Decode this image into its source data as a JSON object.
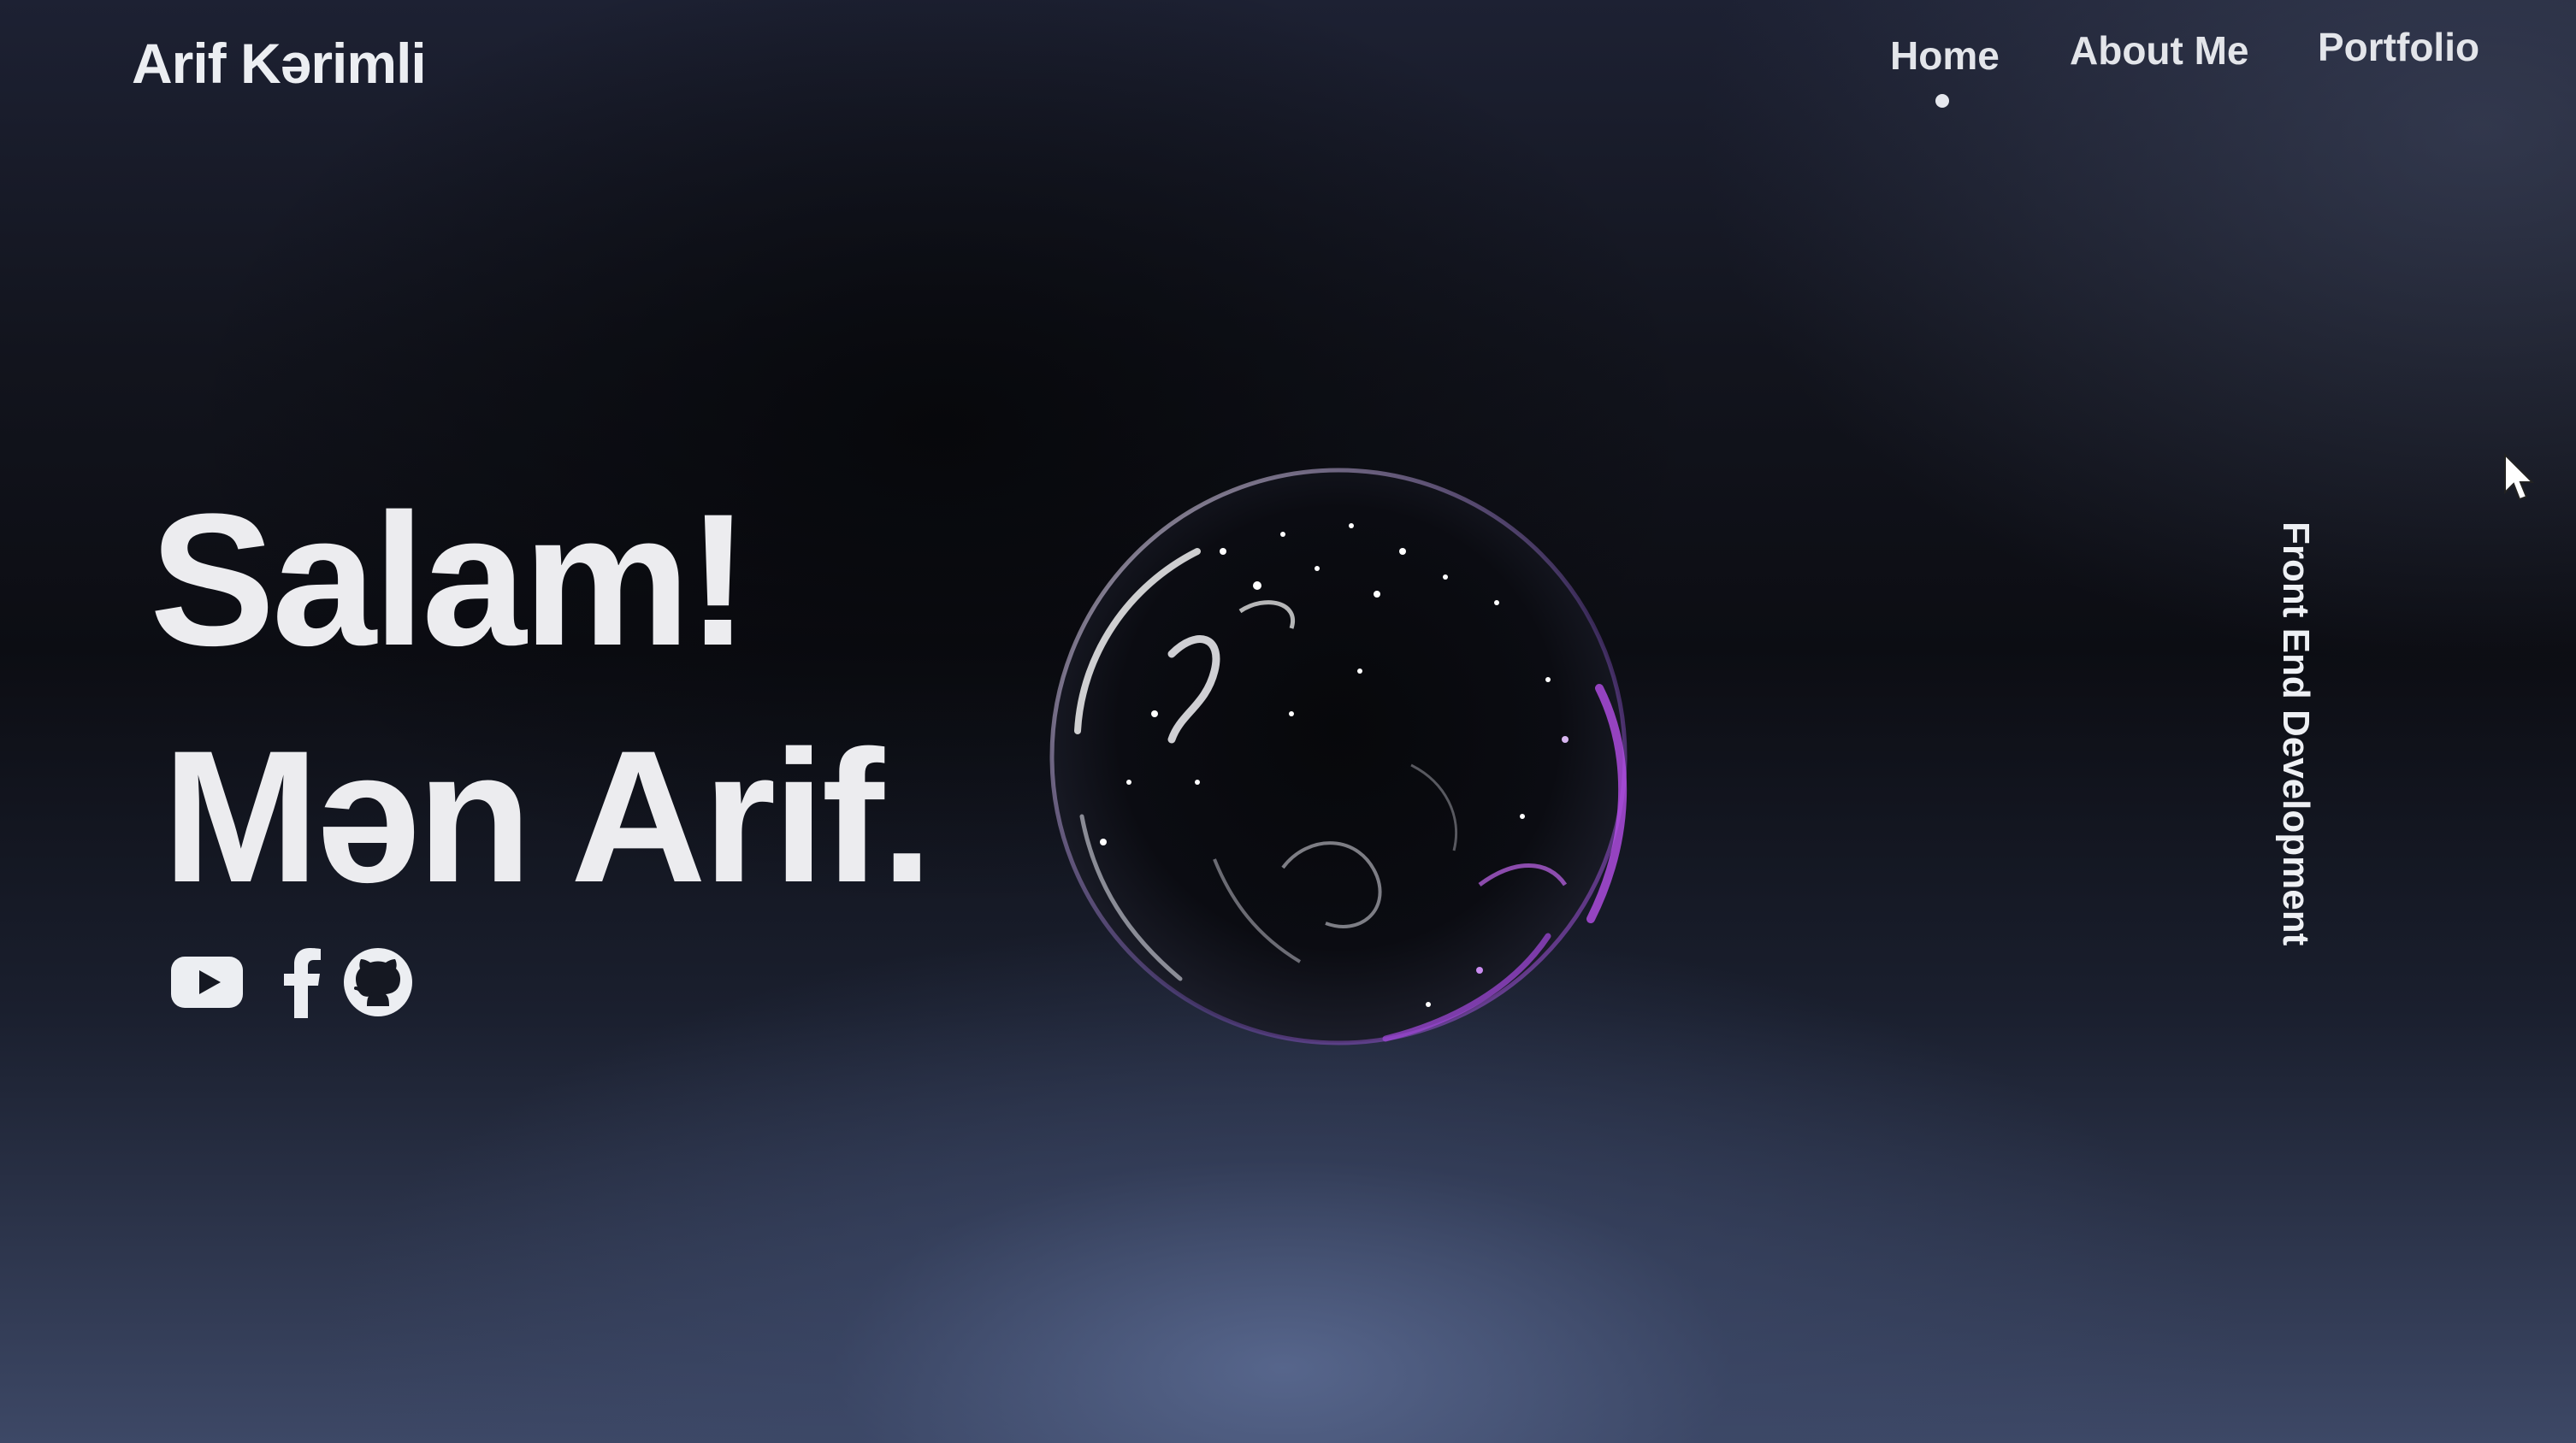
{
  "header": {
    "logo": "Arif Kərimli",
    "nav": [
      {
        "label": "Home",
        "active": true
      },
      {
        "label": "About Me",
        "active": false
      },
      {
        "label": "Portfolio",
        "active": false
      }
    ]
  },
  "hero": {
    "line1": "Salam!",
    "line2": "Mən Arif.",
    "tagline": "Front End Development",
    "socials": [
      "youtube-icon",
      "facebook-icon",
      "github-icon"
    ]
  },
  "colors": {
    "text": "#ececef",
    "accent": "#a24bd6",
    "background": "#0d0f16"
  }
}
